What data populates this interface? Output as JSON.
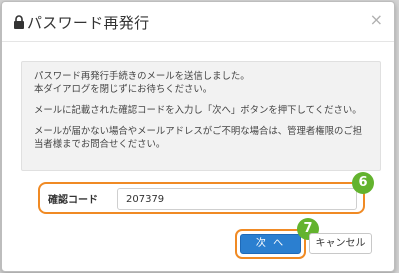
{
  "dialog": {
    "title": "パスワード再発行",
    "close_glyph": "×",
    "lock_icon": "lock-icon"
  },
  "message": {
    "paragraphs": [
      [
        "パスワード再発行手続きのメールを送信しました。",
        "本ダイアログを閉じずにお待ちください。"
      ],
      [
        "メールに記載された確認コードを入力し「次へ」ボタンを押下してください。"
      ],
      [
        "メールが届かない場合やメールアドレスがご不明な場合は、管理者権限のご担",
        "当者様までお問合せください。"
      ]
    ]
  },
  "form": {
    "label": "確認コード",
    "value": "207379"
  },
  "badges": {
    "step6": "6",
    "step7": "7"
  },
  "buttons": {
    "next": "次 へ",
    "cancel": "キャンセル"
  },
  "colors": {
    "highlight": "#f08a24",
    "badge": "#63b32e",
    "primary": "#2b7fd0"
  }
}
